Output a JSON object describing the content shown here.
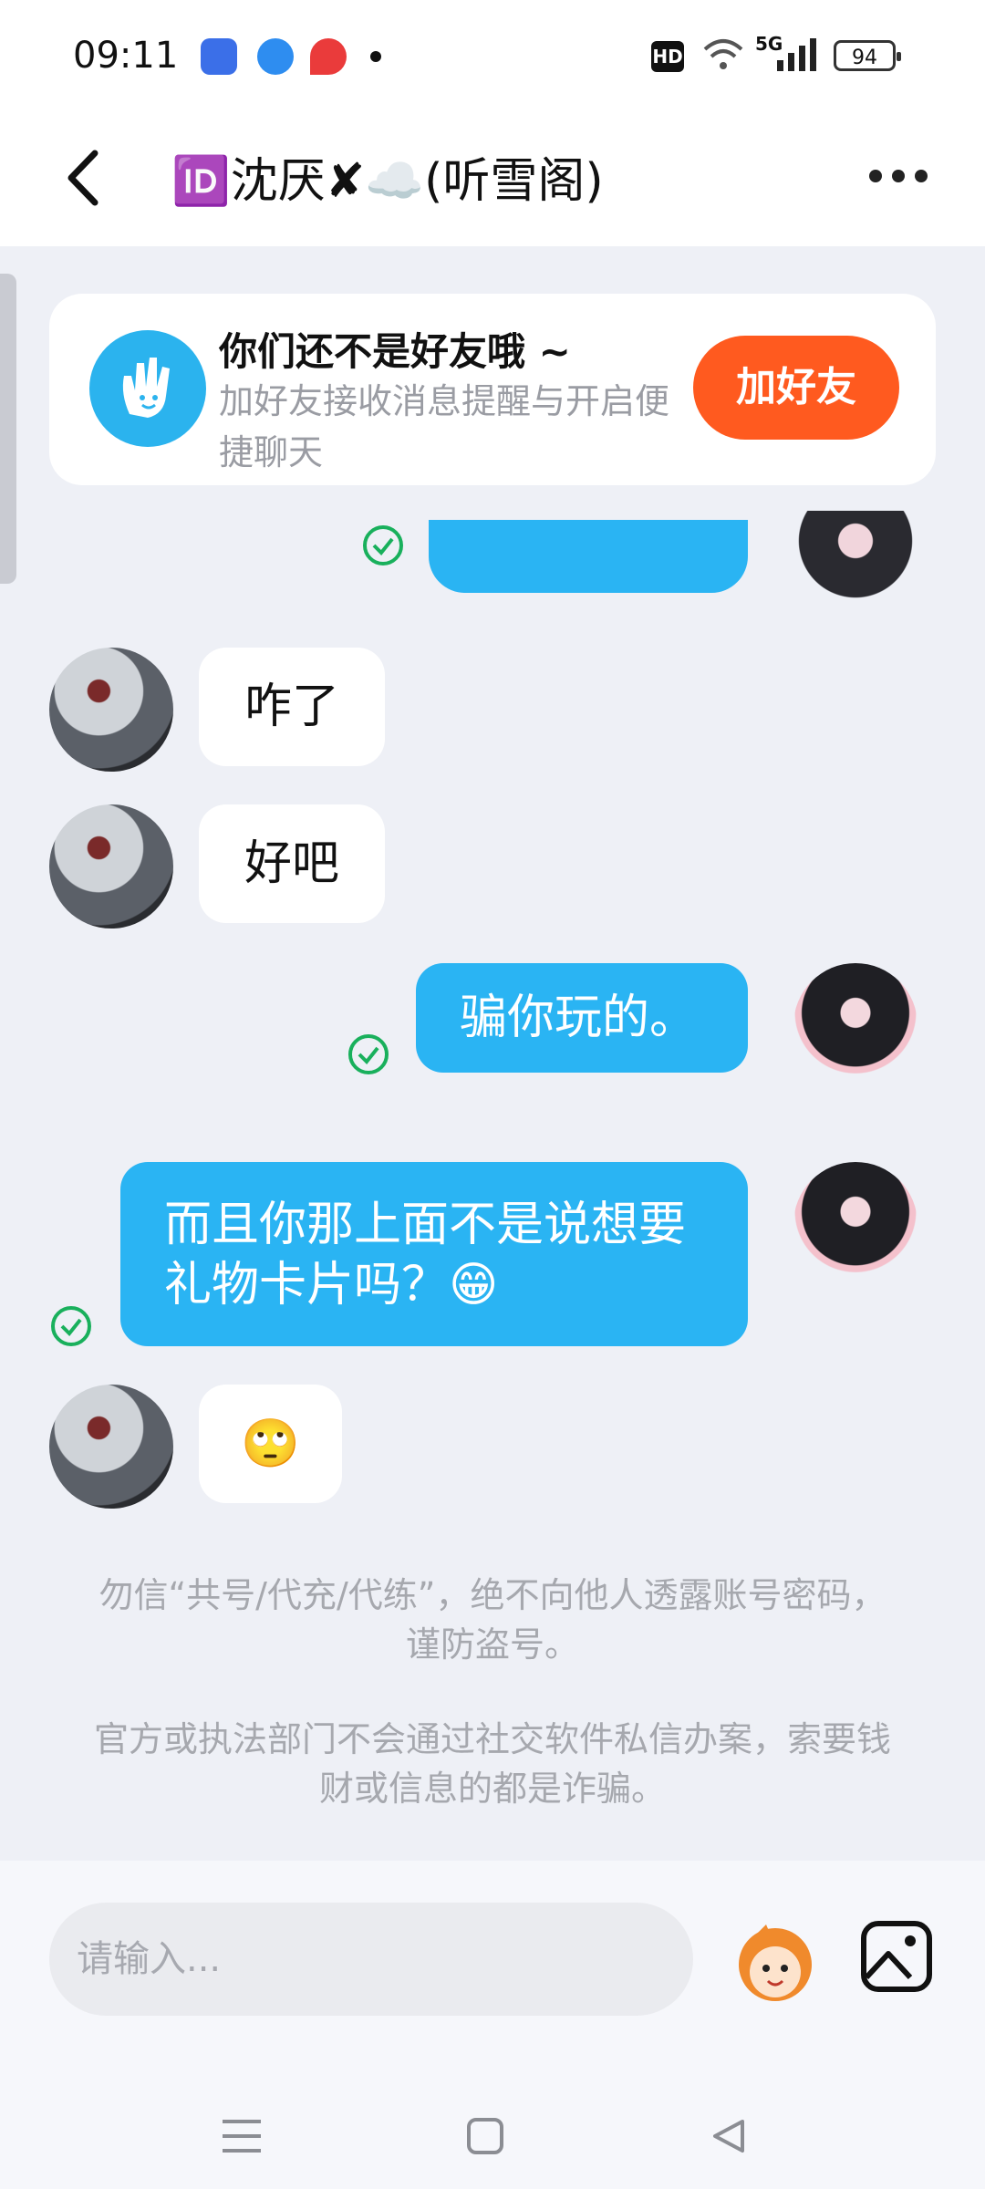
{
  "status_bar": {
    "time": "09:11",
    "network": "5G",
    "battery": "94",
    "hd": "HD"
  },
  "header": {
    "title": "🆔沈厌✘☁️(听雪阁)"
  },
  "friend_banner": {
    "title": "你们还不是好友哦 ~",
    "description": "加好友接收消息提醒与开启便捷聊天",
    "button_label": "加好友"
  },
  "messages": [
    {
      "side": "in",
      "text": "咋了"
    },
    {
      "side": "in",
      "text": "好吧"
    },
    {
      "side": "out",
      "text": "骗你玩的。",
      "read": true
    },
    {
      "side": "out",
      "text": "而且你那上面不是说想要礼物卡片吗？😁",
      "read": true
    },
    {
      "side": "in",
      "text": "🙄"
    }
  ],
  "notices": {
    "fraud_1": "勿信“共号/代充/代练”，绝不向他人透露账号密码，谨防盗号。",
    "fraud_2": "官方或执法部门不会通过社交软件私信办案，索要钱财或信息的都是诈骗。"
  },
  "input": {
    "placeholder": "请输入..."
  },
  "colors": {
    "accent_blue": "#2ab4f3",
    "add_friend_orange": "#ff5a1f",
    "read_check_green": "#19b05c"
  }
}
